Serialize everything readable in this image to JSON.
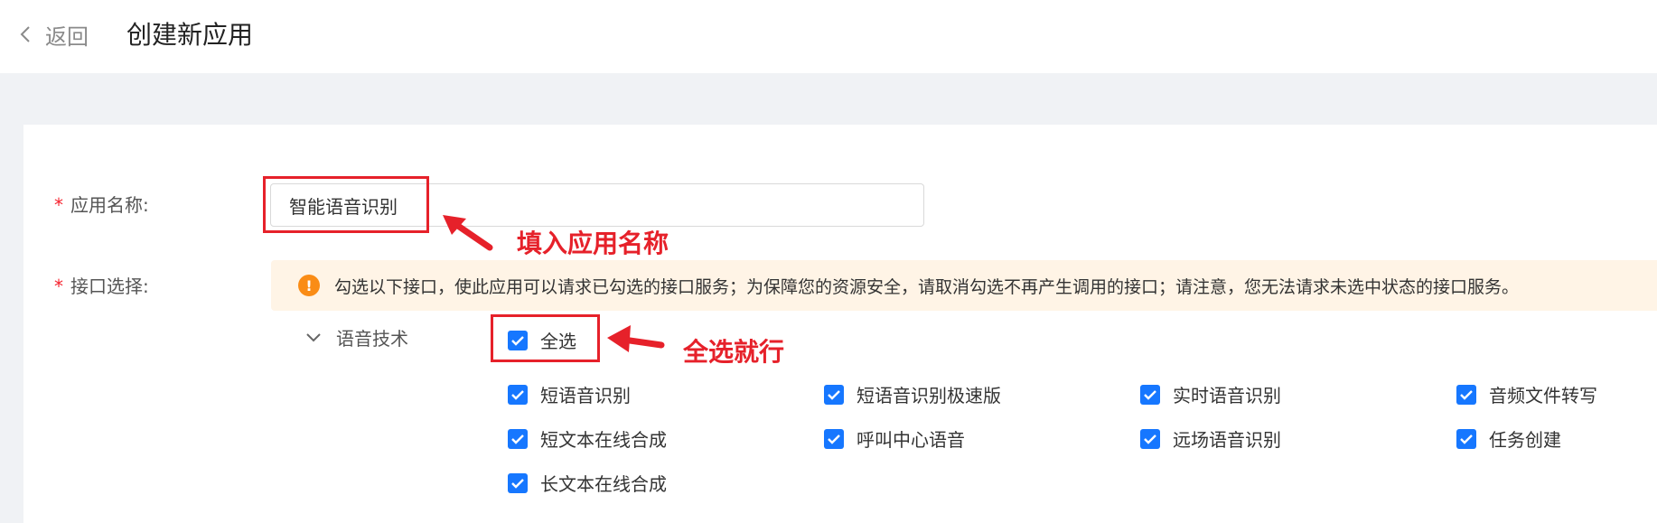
{
  "header": {
    "back_label": "返回",
    "title": "创建新应用"
  },
  "form": {
    "name_label": "应用名称:",
    "name_value": "智能语音识别",
    "api_label": "接口选择:",
    "required_mark": "*"
  },
  "notice": {
    "icon": "!",
    "text": "勾选以下接口，使此应用可以请求已勾选的接口服务；为保障您的资源安全，请取消勾选不再产生调用的接口；请注意，您无法请求未选中状态的接口服务。"
  },
  "group": {
    "label": "语音技术",
    "select_all": "全选",
    "items": [
      "短语音识别",
      "短语音识别极速版",
      "实时语音识别",
      "音频文件转写",
      "短文本在线合成",
      "呼叫中心语音",
      "远场语音识别",
      "任务创建",
      "长文本在线合成"
    ]
  },
  "annotations": {
    "name_hint": "填入应用名称",
    "select_hint": "全选就行"
  },
  "colors": {
    "accent": "#1677ff",
    "annotation": "#e6212a",
    "notice_bg": "#fff4e6",
    "warning_icon": "#fa8c16"
  },
  "icons": [
    "chevron-left-icon",
    "warning-icon",
    "chevron-down-icon",
    "checkmark-icon",
    "arrow-icon"
  ]
}
